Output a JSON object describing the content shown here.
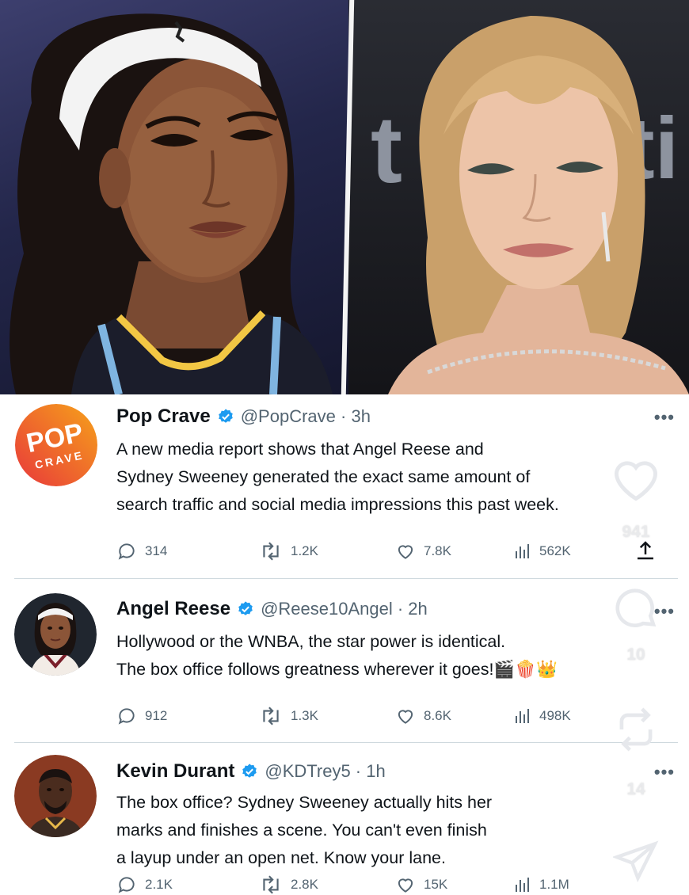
{
  "tweets": [
    {
      "name": "Pop Crave",
      "handle": "@PopCrave",
      "time": "3h",
      "avatar_text_top": "POP",
      "avatar_text_bottom": "CRAVE",
      "text_lines": [
        "A new media report shows that Angel Reese and",
        "Sydney Sweeney generated the exact same amount of",
        "search traffic and social media impressions this past week."
      ],
      "replies": "314",
      "retweets": "1.2K",
      "likes": "7.8K",
      "views": "562K"
    },
    {
      "name": "Angel Reese",
      "handle": "@Reese10Angel",
      "time": "2h",
      "text_lines": [
        "Hollywood or the WNBA, the star power is identical.",
        "The box office follows greatness wherever it goes!🎬🍿👑"
      ],
      "replies": "912",
      "retweets": "1.3K",
      "likes": "8.6K",
      "views": "498K"
    },
    {
      "name": "Kevin Durant",
      "handle": "@KDTrey5",
      "time": "1h",
      "text_lines": [
        "The box office? Sydney Sweeney actually hits her",
        "marks and finishes a scene. You can't even finish",
        "a layup under an open net. Know your lane."
      ],
      "replies": "2.1K",
      "retweets": "2.8K",
      "likes": "15K",
      "views": "1.1M"
    }
  ],
  "overlay": {
    "like_count": "941",
    "comment_count": "10",
    "repost_count": "14"
  },
  "more_label": "•••",
  "colors": {
    "verified": "#1d9bf0",
    "muted": "#536471",
    "separator": "#cfd9de",
    "pop_crave_red": "#e8383b",
    "pop_crave_orange": "#f6a21a"
  }
}
